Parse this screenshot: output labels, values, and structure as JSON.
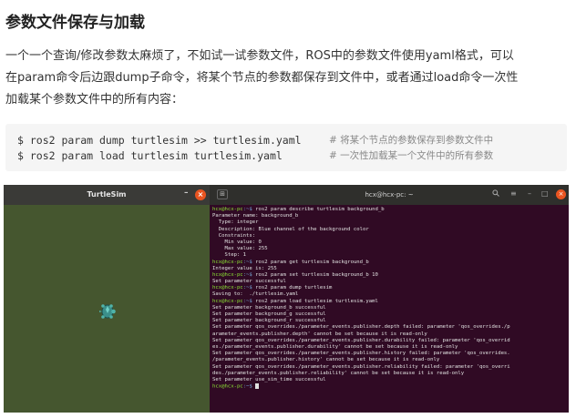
{
  "title": "参数文件保存与加载",
  "paragraph_lines": [
    "一个一个查询/修改参数太麻烦了，不如试一试参数文件，ROS中的参数文件使用yaml格式，可以",
    "在param命令后边跟dump子命令，将某个节点的参数都保存到文件中，或者通过load命令一次性",
    "加载某个参数文件中的所有内容："
  ],
  "code": [
    {
      "cmd": "$ ros2 param dump turtlesim >> turtlesim.yaml",
      "comment": "# 将某个节点的参数保存到参数文件中"
    },
    {
      "cmd": "$ ros2 param load turtlesim turtlesim.yaml",
      "comment": "# 一次性加载某一个文件中的所有参数"
    }
  ],
  "turtlesim": {
    "window_title": "TurtleSim",
    "minimize_symbol": "–",
    "close_symbol": "×",
    "background_color": "#45562f"
  },
  "terminal": {
    "window_title": "hcx@hcx-pc: ~",
    "new_tab_symbol": "⊞",
    "search_symbol": "🔍",
    "menu_symbol": "≡",
    "minimize_symbol": "–",
    "maximize_symbol": "□",
    "close_symbol": "×",
    "prompt_user": "hcx@hcx-pc",
    "prompt_path": ":~$ ",
    "lines": [
      {
        "type": "prompt",
        "text": "ros2 param describe turtlesim background_b"
      },
      {
        "type": "out",
        "text": "Parameter name: background_b"
      },
      {
        "type": "out",
        "text": "  Type: integer"
      },
      {
        "type": "out",
        "text": "  Description: Blue channel of the background color"
      },
      {
        "type": "out",
        "text": "  Constraints:"
      },
      {
        "type": "out",
        "text": "    Min value: 0"
      },
      {
        "type": "out",
        "text": "    Max value: 255"
      },
      {
        "type": "out",
        "text": "    Step: 1"
      },
      {
        "type": "prompt",
        "text": "ros2 param get turtlesim background_b"
      },
      {
        "type": "out",
        "text": "Integer value is: 255"
      },
      {
        "type": "prompt",
        "text": "ros2 param set turtlesim background_b 10"
      },
      {
        "type": "out",
        "text": "Set parameter successful"
      },
      {
        "type": "prompt",
        "text": "ros2 param dump turtlesim"
      },
      {
        "type": "out",
        "text": "Saving to:  ./turtlesim.yaml"
      },
      {
        "type": "prompt",
        "text": "ros2 param load turtlesim turtlesim.yaml"
      },
      {
        "type": "out",
        "text": "Set parameter background_b successful"
      },
      {
        "type": "out",
        "text": "Set parameter background_g successful"
      },
      {
        "type": "out",
        "text": "Set parameter background_r successful"
      },
      {
        "type": "out",
        "text": "Set parameter qos_overrides./parameter_events.publisher.depth failed: parameter 'qos_overrides./p"
      },
      {
        "type": "out",
        "text": "arameter_events.publisher.depth' cannot be set because it is read-only"
      },
      {
        "type": "out",
        "text": "Set parameter qos_overrides./parameter_events.publisher.durability failed: parameter 'qos_overrid"
      },
      {
        "type": "out",
        "text": "es./parameter_events.publisher.durability' cannot be set because it is read-only"
      },
      {
        "type": "out",
        "text": "Set parameter qos_overrides./parameter_events.publisher.history failed: parameter 'qos_overrides."
      },
      {
        "type": "out",
        "text": "/parameter_events.publisher.history' cannot be set because it is read-only"
      },
      {
        "type": "out",
        "text": "Set parameter qos_overrides./parameter_events.publisher.reliability failed: parameter 'qos_overri"
      },
      {
        "type": "out",
        "text": "des./parameter_events.publisher.reliability' cannot be set because it is read-only"
      },
      {
        "type": "out",
        "text": "Set parameter use_sim_time successful"
      },
      {
        "type": "cursor",
        "text": ""
      }
    ]
  }
}
